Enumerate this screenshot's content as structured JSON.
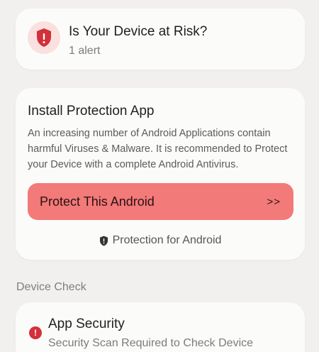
{
  "risk_card": {
    "title": "Is Your Device at Risk?",
    "subtitle": "1 alert",
    "icon": "shield-alert-icon",
    "icon_bg": "#fbe0e0",
    "icon_color": "#d3303a"
  },
  "install_card": {
    "title": "Install Protection App",
    "description": "An increasing number of Android Applications contain harmful Viruses & Malware. It is recommended to Protect your Device with a complete Android Antivirus.",
    "button_label": "Protect This Android",
    "button_arrows": ">>",
    "button_color": "#f27a79",
    "footnote": "Protection for Android",
    "footnote_icon": "shield-icon"
  },
  "device_check": {
    "section_label": "Device Check",
    "items": [
      {
        "title": "App Security",
        "subtitle": "Security Scan Required to Check Device",
        "status_icon": "alert-circle-icon",
        "status_color": "#d3303a"
      }
    ]
  }
}
